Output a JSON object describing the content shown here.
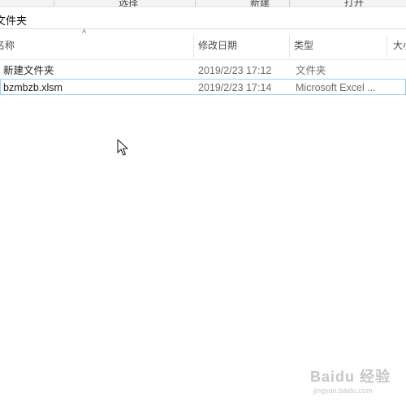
{
  "ribbon": {
    "fragments": [
      "选择",
      "新建",
      "打开"
    ]
  },
  "address": {
    "path": "文件夹"
  },
  "columns": {
    "name": "名称",
    "modified": "修改日期",
    "type": "类型",
    "size": "大小"
  },
  "files": [
    {
      "name": "新建文件夹",
      "modified": "2019/2/23 17:12",
      "type": "文件夹",
      "selected": false
    },
    {
      "name": "bzmbzb.xlsm",
      "modified": "2019/2/23 17:14",
      "type": "Microsoft Excel ...",
      "selected": true
    }
  ],
  "watermark": {
    "brand": "Baidu 经验",
    "url": "jingyan.baidu.com"
  },
  "icons": {
    "sort": "sort-ascending-icon",
    "cursor": "mouse-pointer-icon"
  }
}
